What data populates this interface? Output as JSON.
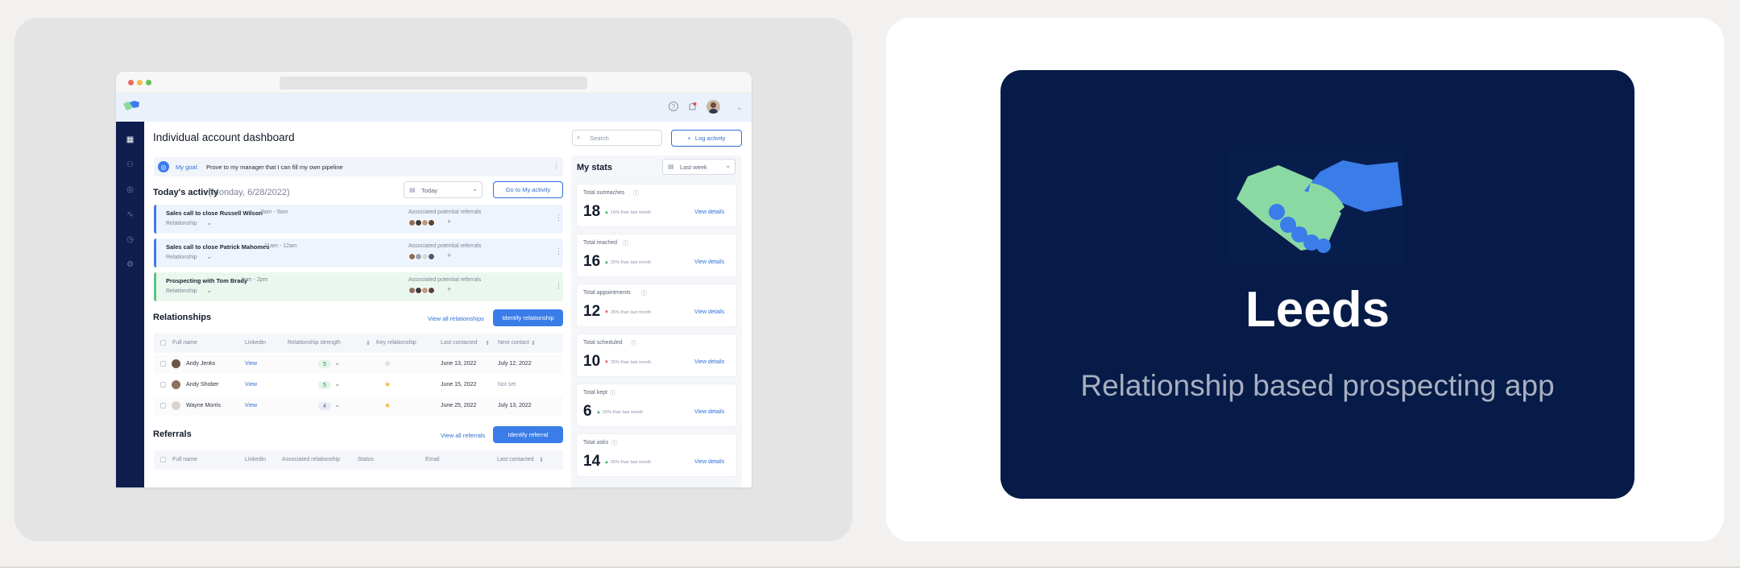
{
  "browser": {
    "dot_colors": [
      "#ee6a5f",
      "#f5bd4f",
      "#61c454"
    ]
  },
  "header": {
    "help_icon": "help-circle-icon",
    "bell_icon": "bell-icon",
    "bell_badge_color": "#e5484d"
  },
  "sidebar": {
    "icons": [
      "grid-icon",
      "users-icon",
      "target-icon",
      "activity-icon",
      "clock-icon",
      "settings-icon"
    ]
  },
  "dashboard": {
    "title": "Individual account dashboard",
    "search_placeholder": "Search",
    "log_activity_label": "Log activity",
    "goal_label": "My goal:",
    "goal_text": "Prove to my manager that I can fill my own pipeline",
    "todays_activity_label": "Today's activity",
    "todays_activity_date": "(Monday, 6/28/2022)",
    "date_filter": "Today",
    "go_to_activity_label": "Go to My activity",
    "activities": [
      {
        "title": "Sales call to close Russell Wilson",
        "time": "8am - 9am",
        "type": "Relationship",
        "referrals_label": "Associated potential referrals"
      },
      {
        "title": "Sales call to close Patrick Mahomes",
        "time": "11am - 12am",
        "type": "Relationship",
        "referrals_label": "Associated potential referrals"
      },
      {
        "title": "Prospecting with Tom Brady",
        "time": "1pm - 2pm",
        "type": "Relationship",
        "referrals_label": "Associated potential referrals"
      }
    ],
    "relationships": {
      "title": "Relationships",
      "view_all_label": "View all relationships",
      "identify_label": "Identify relationship",
      "columns": [
        "Full name",
        "Linkedin",
        "Relationship strength",
        "Key relationship",
        "Last contacted",
        "Next contact"
      ],
      "rows": [
        {
          "name": "Andy Jenks",
          "linkedin": "View",
          "strength": "5",
          "key": false,
          "last": "June 13, 2022",
          "next": "July 12, 2022"
        },
        {
          "name": "Andy Shober",
          "linkedin": "View",
          "strength": "5",
          "key": true,
          "last": "June 15, 2022",
          "next": "Not set"
        },
        {
          "name": "Wayne Morris",
          "linkedin": "View",
          "strength": "4",
          "key": true,
          "last": "June 25, 2022",
          "next": "July 13, 2022"
        }
      ]
    },
    "referrals": {
      "title": "Referrals",
      "view_all_label": "View all referrals",
      "identify_label": "Identify referral",
      "columns": [
        "Full name",
        "Linkedin",
        "Associated relationship",
        "Status",
        "Email",
        "Last contacted"
      ]
    }
  },
  "stats": {
    "title": "My stats",
    "period": "Last week",
    "view_details_label": "View details",
    "items": [
      {
        "label": "Total outreaches",
        "value": "18",
        "trend": "up",
        "change": "16% than last month"
      },
      {
        "label": "Total reached",
        "value": "16",
        "trend": "up",
        "change": "25% than last month"
      },
      {
        "label": "Total appointments",
        "value": "12",
        "trend": "down",
        "change": "25% than last month"
      },
      {
        "label": "Total scheduled",
        "value": "10",
        "trend": "down",
        "change": "25% than last month"
      },
      {
        "label": "Total kept",
        "value": "6",
        "trend": "up",
        "change": "25% than last month"
      },
      {
        "label": "Total asks",
        "value": "14",
        "trend": "up",
        "change": "25% than last month"
      }
    ]
  },
  "hero": {
    "title": "Leeds",
    "subtitle": "Relationship based prospecting app",
    "icon": "handshake-icon",
    "bg_color": "#061b47",
    "green": "#8ad9a3",
    "blue": "#3a7de8"
  }
}
